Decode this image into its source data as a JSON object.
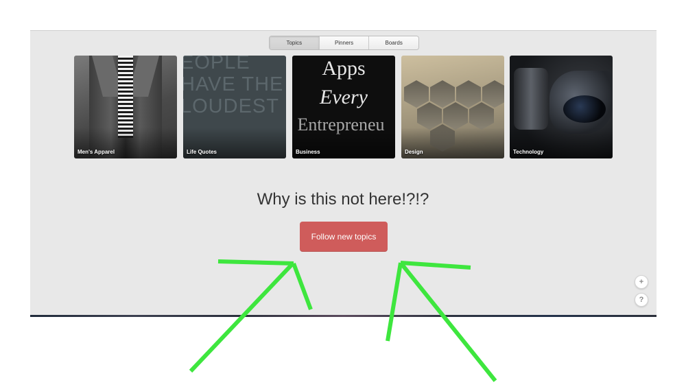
{
  "tabs": [
    {
      "label": "Topics",
      "active": true
    },
    {
      "label": "Pinners",
      "active": false
    },
    {
      "label": "Boards",
      "active": false
    }
  ],
  "topics": [
    {
      "label": "Men's Apparel"
    },
    {
      "label": "Life Quotes",
      "image_text": [
        "EOPLE",
        "HAVE THE",
        "LOUDEST"
      ]
    },
    {
      "label": "Business",
      "image_text": [
        "Apps",
        "Every",
        "Entrepreneu"
      ]
    },
    {
      "label": "Design"
    },
    {
      "label": "Technology"
    }
  ],
  "main": {
    "heading": "Why is this not here!?!?",
    "follow_button": "Follow new topics"
  },
  "floating": {
    "plus_icon": "+",
    "help_icon": "?"
  },
  "colors": {
    "panel_bg": "#e8e8e8",
    "button_red": "#cf5c5b",
    "arrow_green": "#3ee63e"
  }
}
